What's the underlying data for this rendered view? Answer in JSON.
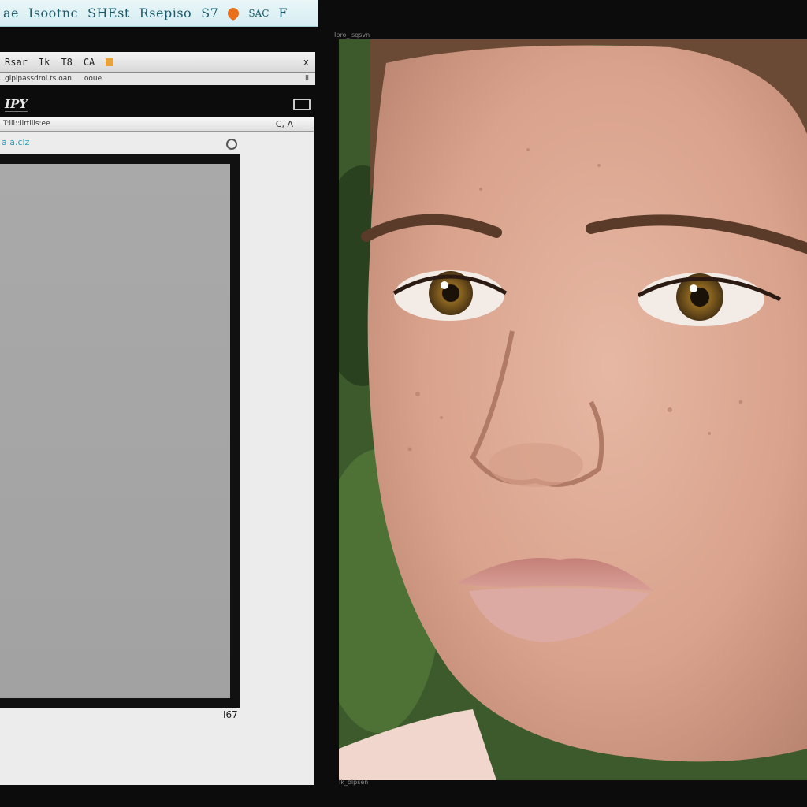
{
  "menubar": {
    "items": [
      "ae",
      "Isootnc",
      "SHEst",
      "Rsepiso",
      "S7"
    ],
    "badge_label": "SAC",
    "tail": "F"
  },
  "left_window": {
    "address_bar": {
      "items": [
        "Rsar",
        "Ik",
        "T8",
        "CA"
      ],
      "close": "x"
    },
    "sub_bar": {
      "url": "giplpassdrol.ts.oan",
      "mid": "ooue",
      "end": "ll"
    },
    "logo": "IPY",
    "document": {
      "header_label": "T:lii::lirtiiis:ee",
      "header_right": "C, A",
      "subtitle": "a a.clz",
      "page_number": "I67"
    }
  },
  "photo_window": {
    "top_label": "Ipro_ sqsvn",
    "status_text": "Ik_olpsen"
  },
  "colors": {
    "menubar_text": "#1a5a6a",
    "accent_link": "#2b9bb3",
    "badge": "#e8701a"
  }
}
